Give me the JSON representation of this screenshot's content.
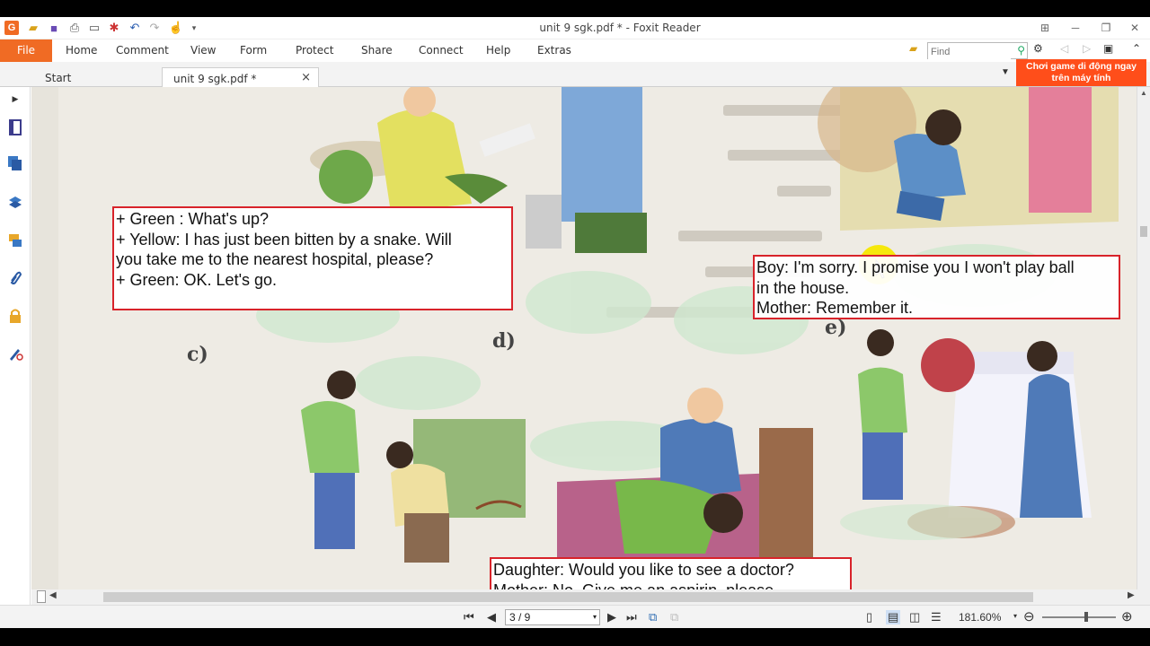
{
  "window": {
    "title": "unit 9 sgk.pdf * - Foxit Reader",
    "controls": {
      "menu_icon": "grid-icon",
      "minimize": "─",
      "restore": "❐",
      "close": "✕"
    }
  },
  "ribbon": {
    "file": "File",
    "tabs": [
      "Home",
      "Comment",
      "View",
      "Form",
      "Protect",
      "Share",
      "Connect",
      "Help",
      "Extras"
    ],
    "find_placeholder": "Find"
  },
  "doc_tabs": {
    "start": "Start",
    "active": "unit 9 sgk.pdf *",
    "close": "×"
  },
  "ad_banner": {
    "line1": "Chơi game di động ngay",
    "line2": "trên máy tính"
  },
  "document": {
    "callout_a": {
      "lines": [
        "+ Green : What's up?",
        "+ Yellow: I has just been bitten by a snake. Will",
        "you take me to the nearest hospital, please?",
        "+ Green: OK. Let's go."
      ]
    },
    "callout_b": {
      "lines": [
        "Boy: I'm sorry. I promise you I won't play ball",
        "in the house.",
        "Mother: Remember it."
      ]
    },
    "callout_c": {
      "lines": [
        "Daughter: Would you like to see a doctor?",
        "Mother: No. Give me an aspirin, please."
      ]
    },
    "labels": {
      "c": "c)",
      "d": "d)",
      "e": "e)"
    }
  },
  "status": {
    "page": "3 / 9",
    "zoom": "181.60%"
  },
  "colors": {
    "accent": "#f06b24",
    "callout_border": "#d8232a",
    "ad": "#ff4e1a"
  }
}
